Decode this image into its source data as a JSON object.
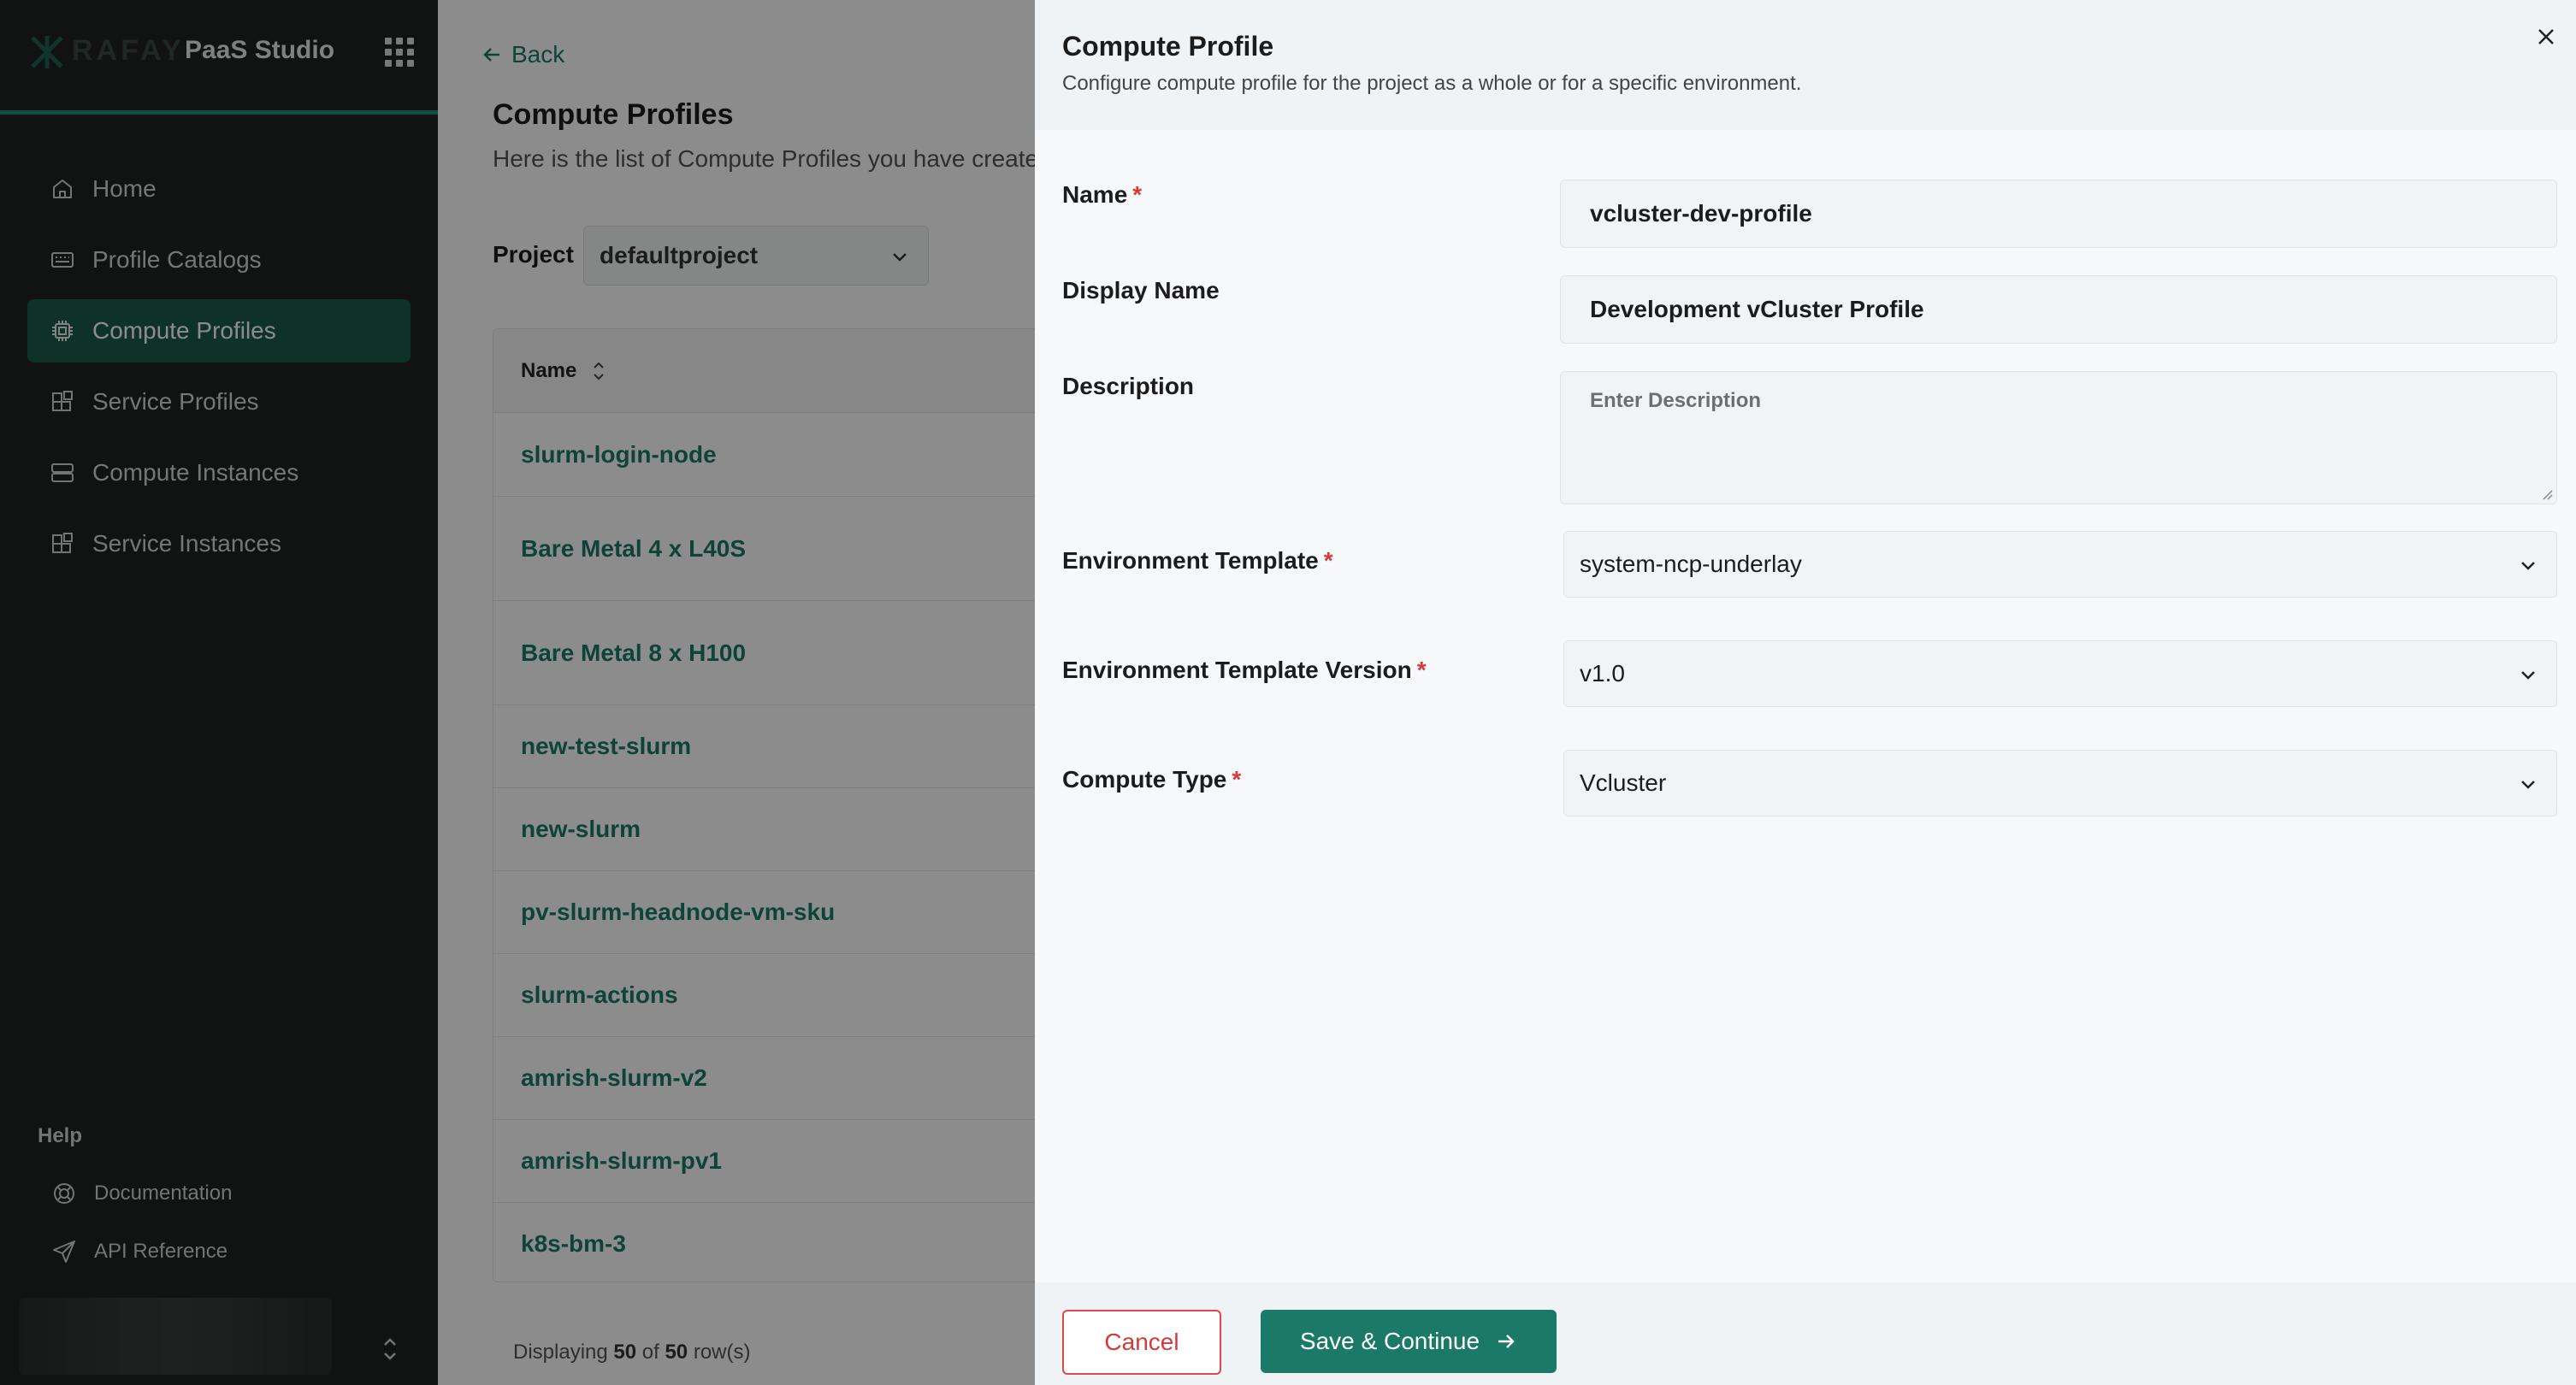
{
  "app": {
    "logo_text": "RAFAY",
    "title": "PaaS Studio"
  },
  "sidebar": {
    "items": [
      {
        "label": "Home",
        "icon": "home-icon"
      },
      {
        "label": "Profile Catalogs",
        "icon": "catalog-icon"
      },
      {
        "label": "Compute Profiles",
        "icon": "chip-icon",
        "active": true
      },
      {
        "label": "Service Profiles",
        "icon": "blocks-icon"
      },
      {
        "label": "Compute Instances",
        "icon": "server-icon"
      },
      {
        "label": "Service Instances",
        "icon": "blocks-icon"
      }
    ],
    "help": {
      "title": "Help",
      "items": [
        {
          "label": "Documentation",
          "icon": "lifebuoy-icon"
        },
        {
          "label": "API Reference",
          "icon": "send-icon"
        }
      ]
    }
  },
  "main": {
    "back_label": "Back",
    "title": "Compute Profiles",
    "subtitle": "Here is the list of Compute Profiles you have create",
    "project_label": "Project",
    "project_value": "defaultproject",
    "table": {
      "column_name": "Name",
      "rows": [
        "slurm-login-node",
        "Bare Metal 4 x L40S",
        "Bare Metal 8 x H100",
        "new-test-slurm",
        "new-slurm",
        "pv-slurm-headnode-vm-sku",
        "slurm-actions",
        "amrish-slurm-v2",
        "amrish-slurm-pv1",
        "k8s-bm-3"
      ]
    },
    "footer": {
      "prefix": "Displaying",
      "shown": "50",
      "of": "of",
      "total": "50",
      "suffix": "row(s)"
    }
  },
  "drawer": {
    "title": "Compute Profile",
    "subtitle": "Configure compute profile for the project as a whole or for a specific environment.",
    "fields": {
      "name": {
        "label": "Name",
        "value": "vcluster-dev-profile",
        "required": true
      },
      "display_name": {
        "label": "Display Name",
        "value": "Development vCluster Profile"
      },
      "description": {
        "label": "Description",
        "placeholder": "Enter Description"
      },
      "env_template": {
        "label": "Environment Template",
        "value": "system-ncp-underlay",
        "required": true
      },
      "env_template_version": {
        "label": "Environment Template Version",
        "value": "v1.0",
        "required": true
      },
      "compute_type": {
        "label": "Compute Type",
        "value": "Vcluster",
        "required": true
      }
    },
    "required_marker": "*",
    "cancel_label": "Cancel",
    "save_label": "Save & Continue"
  },
  "colors": {
    "accent": "#1a7a67",
    "sidebar_bg": "#1f2221",
    "danger": "#d33b3b"
  }
}
